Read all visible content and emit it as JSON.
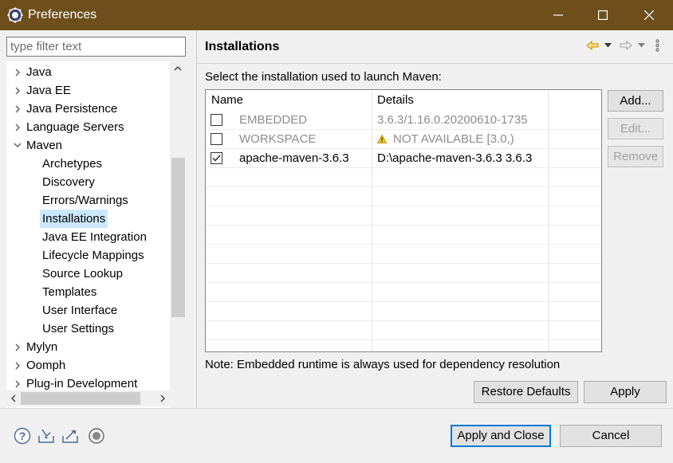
{
  "window": {
    "title": "Preferences",
    "controls": {
      "minimize": "—",
      "maximize": "□",
      "close": "✕"
    }
  },
  "left": {
    "filter_placeholder": "type filter text",
    "tree": [
      {
        "label": "Java",
        "level": 0,
        "state": "collapsed"
      },
      {
        "label": "Java EE",
        "level": 0,
        "state": "collapsed"
      },
      {
        "label": "Java Persistence",
        "level": 0,
        "state": "collapsed"
      },
      {
        "label": "Language Servers",
        "level": 0,
        "state": "collapsed"
      },
      {
        "label": "Maven",
        "level": 0,
        "state": "expanded"
      },
      {
        "label": "Archetypes",
        "level": 1
      },
      {
        "label": "Discovery",
        "level": 1
      },
      {
        "label": "Errors/Warnings",
        "level": 1
      },
      {
        "label": "Installations",
        "level": 1,
        "selected": true
      },
      {
        "label": "Java EE Integration",
        "level": 1
      },
      {
        "label": "Lifecycle Mappings",
        "level": 1
      },
      {
        "label": "Source Lookup",
        "level": 1
      },
      {
        "label": "Templates",
        "level": 1
      },
      {
        "label": "User Interface",
        "level": 1
      },
      {
        "label": "User Settings",
        "level": 1
      },
      {
        "label": "Mylyn",
        "level": 0,
        "state": "collapsed"
      },
      {
        "label": "Oomph",
        "level": 0,
        "state": "collapsed"
      },
      {
        "label": "Plug-in Development",
        "level": 0,
        "state": "collapsed"
      }
    ]
  },
  "page": {
    "title": "Installations",
    "instruction": "Select the installation used to launch Maven:",
    "columns": [
      "Name",
      "Details"
    ],
    "rows": [
      {
        "name": "EMBEDDED",
        "details": "3.6.3/1.16.0.20200610-1735",
        "checked": false,
        "disabled": true,
        "warning": false
      },
      {
        "name": "WORKSPACE",
        "details": "NOT AVAILABLE [3.0,)",
        "checked": false,
        "disabled": true,
        "warning": true
      },
      {
        "name": "apache-maven-3.6.3",
        "details": "D:\\apache-maven-3.6.3 3.6.3",
        "checked": true,
        "disabled": false,
        "warning": false
      }
    ],
    "side_buttons": {
      "add": "Add...",
      "edit": "Edit...",
      "remove": "Remove"
    },
    "note": "Note: Embedded runtime is always used for dependency resolution",
    "restore_defaults": "Restore Defaults",
    "apply": "Apply"
  },
  "footer": {
    "apply_and_close": "Apply and Close",
    "cancel": "Cancel"
  },
  "colors": {
    "titlebar": "#6e4f1c",
    "selection": "#cce8ff",
    "default_button_border": "#0078d7",
    "nav_back_arrow": "#e8a000"
  }
}
